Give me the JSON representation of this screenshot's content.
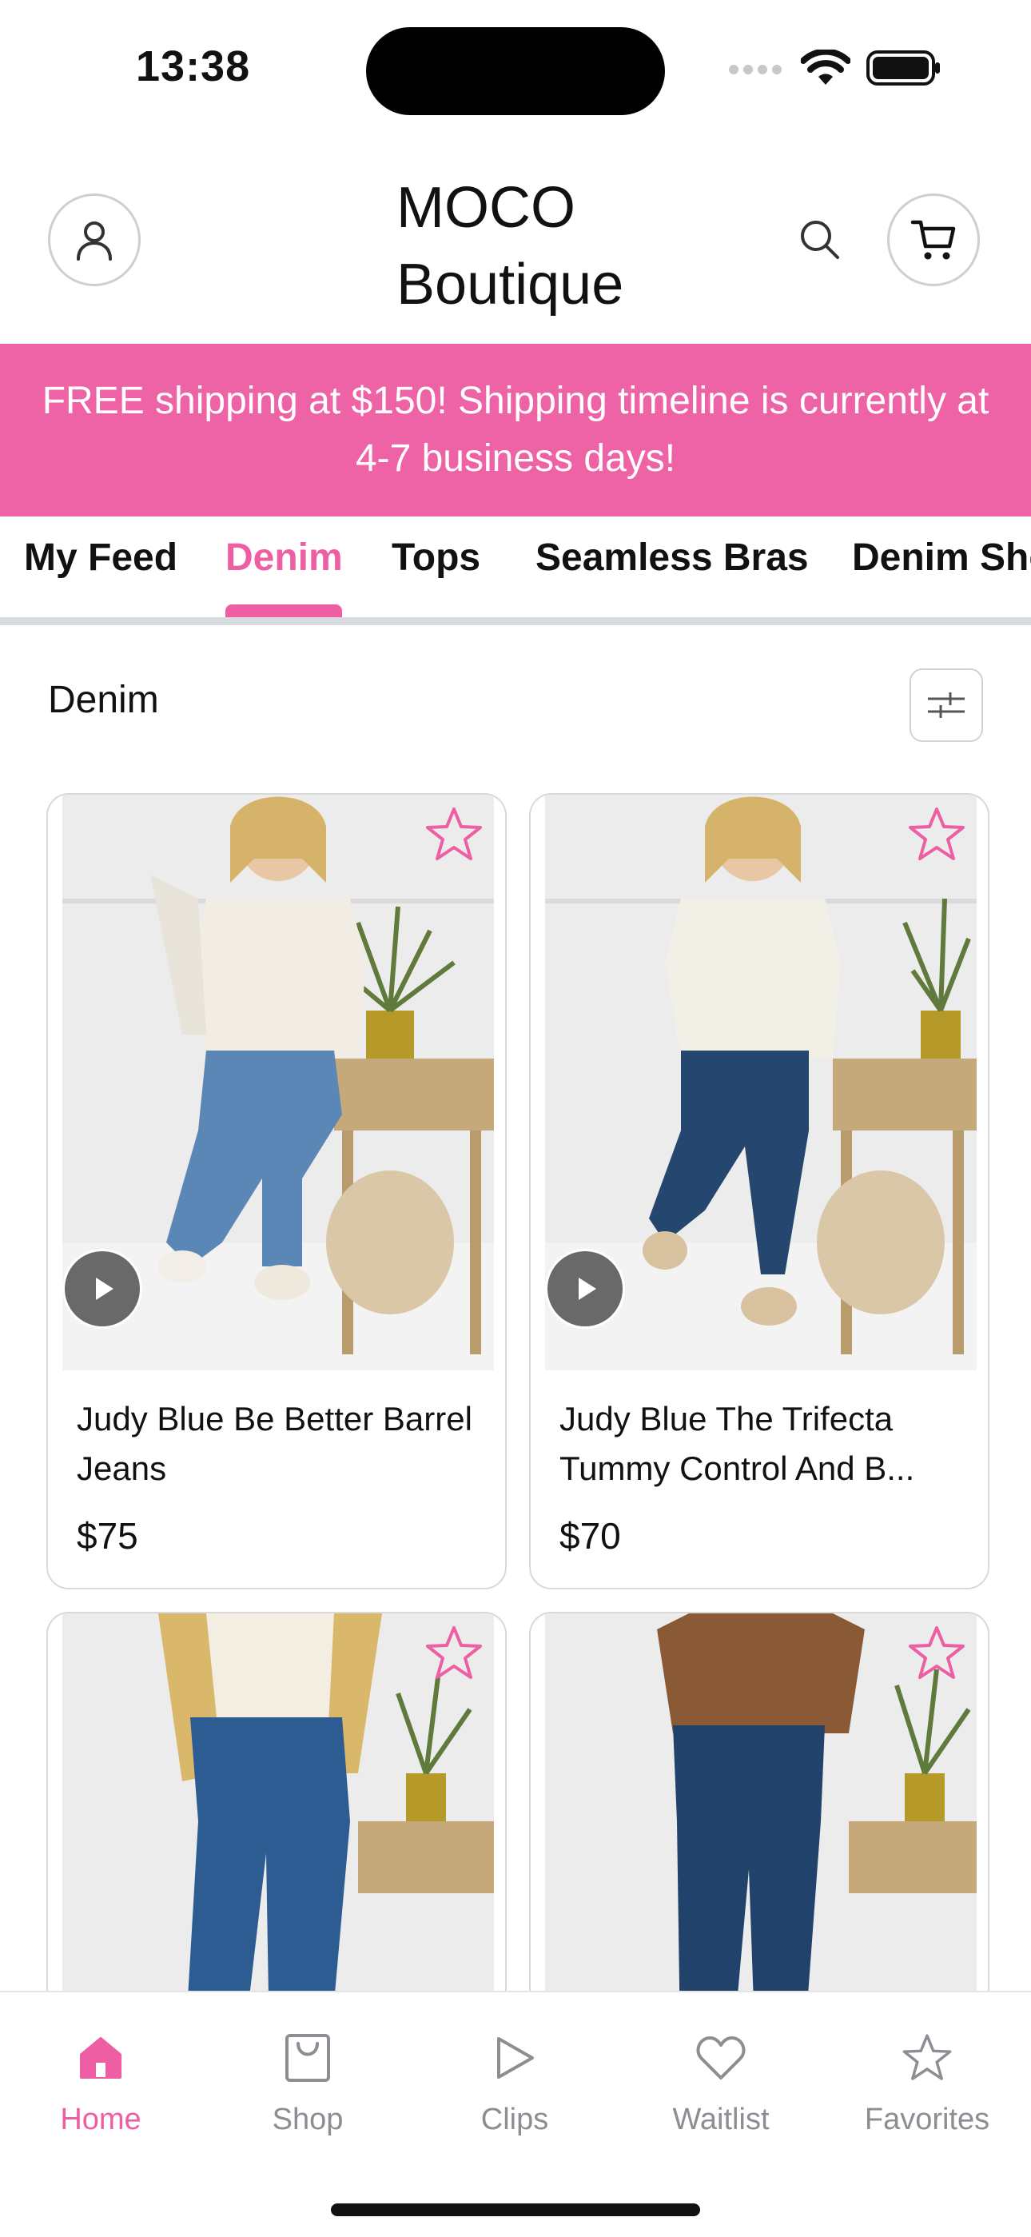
{
  "status_bar": {
    "time": "13:38"
  },
  "header": {
    "brand_line1": "MOCO",
    "brand_line2": "Boutique"
  },
  "banner": {
    "text": "FREE shipping at $150! Shipping timeline is currently at 4-7 business days!"
  },
  "tabs": [
    {
      "label": "My Feed",
      "active": false
    },
    {
      "label": "Denim",
      "active": true
    },
    {
      "label": "Tops",
      "active": false
    },
    {
      "label": "Seamless Bras",
      "active": false
    },
    {
      "label": "Denim Sho",
      "active": false
    }
  ],
  "section": {
    "title": "Denim"
  },
  "products": [
    {
      "name": "Judy Blue Be Better Barrel Jeans",
      "price": "$75",
      "jeans_color": "#5a87b5",
      "top_color": "#f1ede4"
    },
    {
      "name": "Judy Blue The Trifecta Tummy Control And B...",
      "price": "$70",
      "jeans_color": "#24466f",
      "top_color": "#f2efe6"
    },
    {
      "name": "",
      "price": "",
      "jeans_color": "#2d5c92",
      "top_color": "#f4eee2"
    },
    {
      "name": "",
      "price": "",
      "jeans_color": "#21426a",
      "top_color": "#8a5a36"
    }
  ],
  "bottom_nav": [
    {
      "label": "Home",
      "icon": "home-icon",
      "active": true
    },
    {
      "label": "Shop",
      "icon": "shopping-bag-icon",
      "active": false
    },
    {
      "label": "Clips",
      "icon": "play-icon",
      "active": false
    },
    {
      "label": "Waitlist",
      "icon": "heart-icon",
      "active": false
    },
    {
      "label": "Favorites",
      "icon": "star-icon",
      "active": false
    }
  ],
  "colors": {
    "accent": "#ee5ea3",
    "banner": "#ee63a6",
    "inactive": "#8d8d93"
  }
}
